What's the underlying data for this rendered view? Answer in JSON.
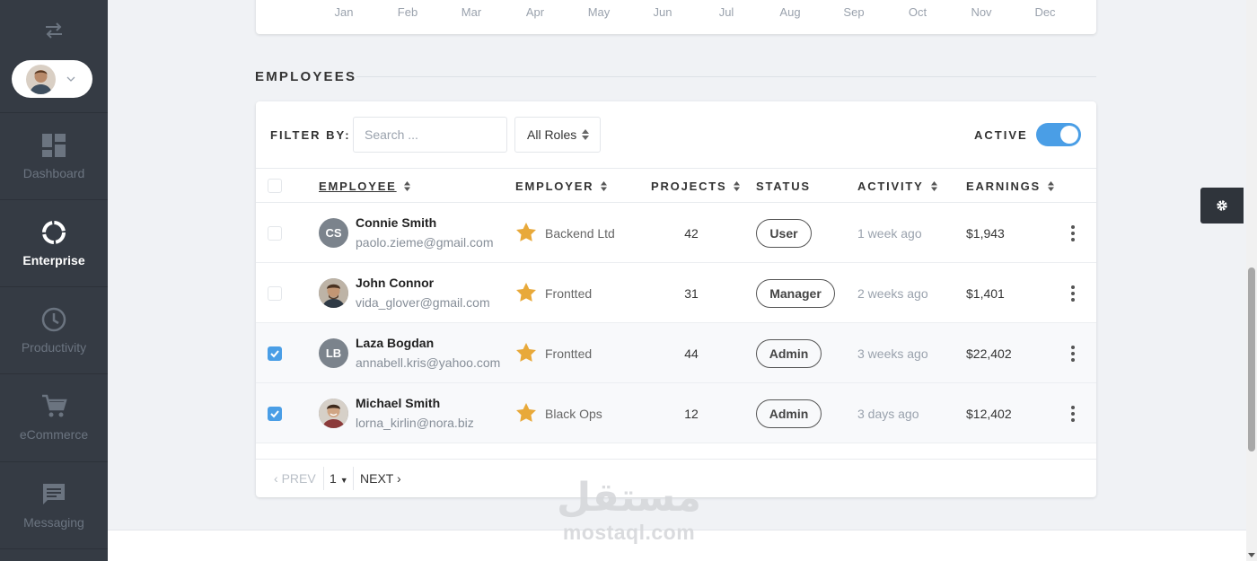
{
  "sidebar": {
    "items": [
      {
        "label": "Dashboard",
        "icon": "dashboard-icon"
      },
      {
        "label": "Enterprise",
        "icon": "enterprise-icon",
        "active": true
      },
      {
        "label": "Productivity",
        "icon": "clock-icon"
      },
      {
        "label": "eCommerce",
        "icon": "cart-icon"
      },
      {
        "label": "Messaging",
        "icon": "message-icon"
      }
    ]
  },
  "chart": {
    "months": [
      "Jan",
      "Feb",
      "Mar",
      "Apr",
      "May",
      "Jun",
      "Jul",
      "Aug",
      "Sep",
      "Oct",
      "Nov",
      "Dec"
    ]
  },
  "section": {
    "title": "EMPLOYEES"
  },
  "filters": {
    "label": "FILTER BY:",
    "search_placeholder": "Search ...",
    "role_value": "All Roles",
    "active_label": "ACTIVE",
    "active_on": true
  },
  "table": {
    "headers": [
      "EMPLOYEE",
      "EMPLOYER",
      "PROJECTS",
      "STATUS",
      "ACTIVITY",
      "EARNINGS"
    ],
    "rows": [
      {
        "initials": "CS",
        "name": "Connie Smith",
        "email": "paolo.zieme@gmail.com",
        "employer": "Backend Ltd",
        "projects": "42",
        "status": "User",
        "activity": "1 week ago",
        "earnings": "$1,943",
        "checked": false
      },
      {
        "initials": "",
        "name": "John Connor",
        "email": "vida_glover@gmail.com",
        "employer": "Frontted",
        "projects": "31",
        "status": "Manager",
        "activity": "2 weeks ago",
        "earnings": "$1,401",
        "checked": false
      },
      {
        "initials": "LB",
        "name": "Laza Bogdan",
        "email": "annabell.kris@yahoo.com",
        "employer": "Frontted",
        "projects": "44",
        "status": "Admin",
        "activity": "3 weeks ago",
        "earnings": "$22,402",
        "checked": true
      },
      {
        "initials": "",
        "name": "Michael Smith",
        "email": "lorna_kirlin@nora.biz",
        "employer": "Black Ops",
        "projects": "12",
        "status": "Admin",
        "activity": "3 days ago",
        "earnings": "$12,402",
        "checked": true
      }
    ]
  },
  "pager": {
    "prev": "PREV",
    "page": "1",
    "next": "NEXT"
  },
  "watermark": {
    "arabic": "مستقل",
    "latin": "mostaql.com"
  },
  "colors": {
    "accent": "#4a9ee6",
    "sidebar": "#353b44",
    "star": "#e8a93a"
  }
}
